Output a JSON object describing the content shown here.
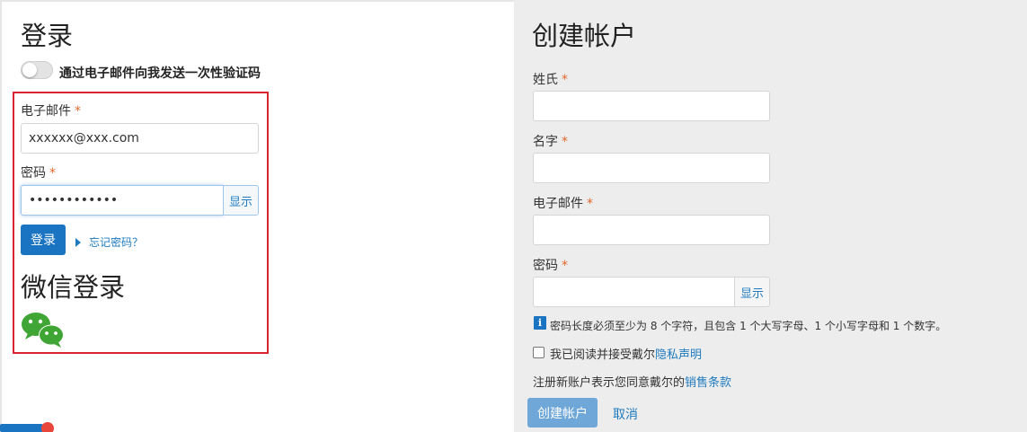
{
  "login": {
    "title": "登录",
    "otp_toggle_label": "通过电子邮件向我发送一次性验证码",
    "email_label": "电子邮件",
    "email_value": "xxxxxx@xxx.com",
    "password_label": "密码",
    "password_value": "••••••••••••",
    "show_label": "显示",
    "login_button": "登录",
    "forgot_link": "忘记密码？",
    "wechat_title": "微信登录",
    "required_mark": "*"
  },
  "register": {
    "title": "创建帐户",
    "last_name_label": "姓氏",
    "first_name_label": "名字",
    "email_label": "电子邮件",
    "password_label": "密码",
    "show_label": "显示",
    "required_mark": "*",
    "password_hint": "密码长度必须至少为 8 个字符，且包含 1 个大写字母、1 个小写字母和 1 个数字。",
    "agree_prefix": "我已阅读并接受戴尔",
    "privacy_link": "隐私声明",
    "terms_prefix": "注册新账户表示您同意戴尔的",
    "terms_link": "销售条款",
    "create_button": "创建帐户",
    "cancel_link": "取消",
    "info_icon_glyph": "i"
  },
  "colors": {
    "primary": "#1a74c1",
    "link": "#1e7bbf",
    "required": "#e0662a",
    "highlight_border": "#d9262e",
    "wechat_green": "#3fa535"
  },
  "icons": [
    "toggle-switch",
    "caret-right-icon",
    "wechat-icon",
    "info-icon",
    "checkbox"
  ]
}
